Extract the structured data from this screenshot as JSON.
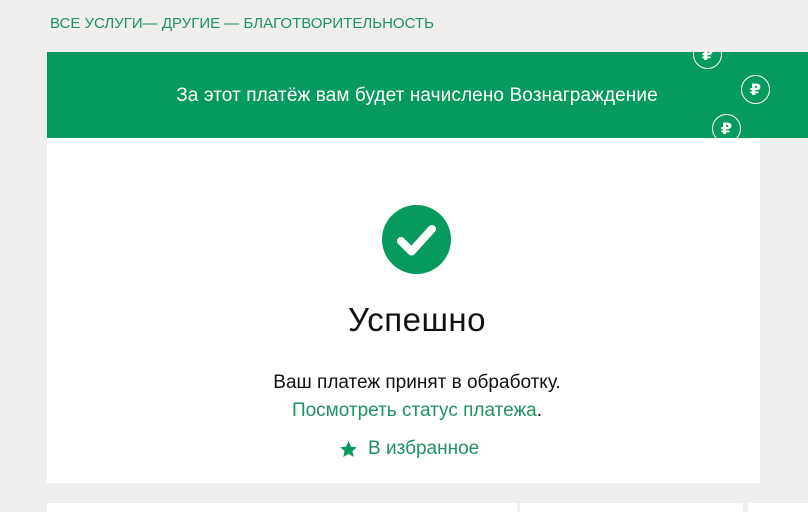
{
  "breadcrumb": {
    "items": [
      "ВСЕ УСЛУГИ",
      "ДРУГИЕ",
      "БЛАГОТВОРИТЕЛЬНОСТЬ"
    ],
    "separator": "—"
  },
  "banner": {
    "text": "За этот платёж вам будет начислено Вознаграждение",
    "coin_symbol": "₽",
    "background": "#079a5e"
  },
  "result": {
    "icon": "check-circle-icon",
    "title": "Успешно",
    "message": "Ваш платеж принят в обработку.",
    "status_link": "Посмотреть статус платежа",
    "status_suffix": ".",
    "favorite_icon": "star-icon",
    "favorite_label": "В избранное"
  },
  "colors": {
    "accent": "#1f9260",
    "page_background": "#f0efed",
    "card_background": "#ffffff"
  }
}
